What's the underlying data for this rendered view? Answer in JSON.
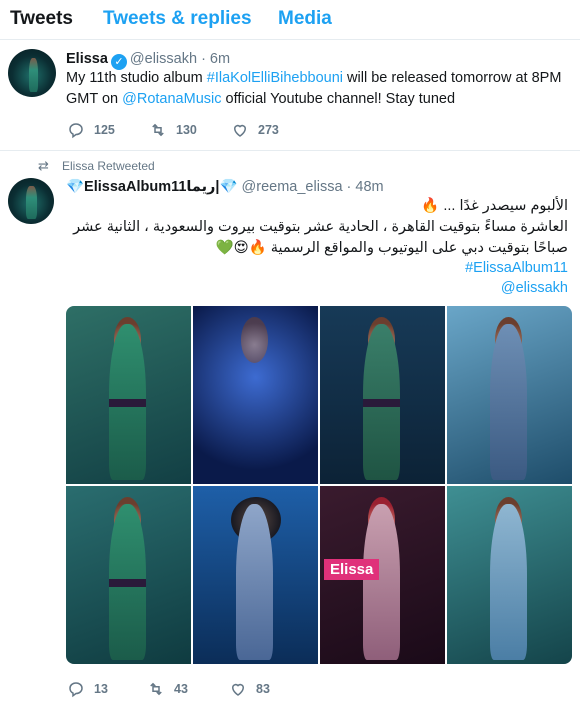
{
  "tabs": [
    {
      "label": "Tweets",
      "active": true
    },
    {
      "label": "Tweets & replies",
      "active": false
    },
    {
      "label": "Media",
      "active": false
    }
  ],
  "tweet1": {
    "name": "Elissa",
    "handle": "@elissakh",
    "time": "· 6m",
    "text_before": "My 11th studio album ",
    "hashtag": "#IlaKolElliBihebbouni",
    "text_mid": " will be released tomorrow at 8PM GMT on ",
    "mention": "@RotanaMusic",
    "text_after": " official Youtube channel! Stay tuned",
    "replies": "125",
    "retweets": "130",
    "likes": "273"
  },
  "tweet2": {
    "retweet_label": "Elissa Retweeted",
    "name": "💎ElissaAlbum11ريما|💎",
    "handle": "@reema_elissa",
    "time": "· 48m",
    "line1": "الألبوم سيصدر غدًا ... 🔥",
    "line2": "العاشرة مساءً بتوقيت القاهرة ، الحادية عشر بتوقيت بيروت والسعودية ، الثانية عشر صباحًا بتوقيت دبي على اليوتيوب والمواقع الرسمية 🔥😍💚",
    "hashtag": "#ElissaAlbum11",
    "mention": "@elissakh",
    "photo_label": "Elissa",
    "replies": "13",
    "retweets": "43",
    "likes": "83"
  },
  "icons": {
    "reply": "reply-icon",
    "retweet": "retweet-icon",
    "like": "heart-icon",
    "verified": "verified-badge-icon"
  },
  "colors": {
    "link": "#1da1f2",
    "muted": "#657786",
    "text": "#14171a"
  }
}
